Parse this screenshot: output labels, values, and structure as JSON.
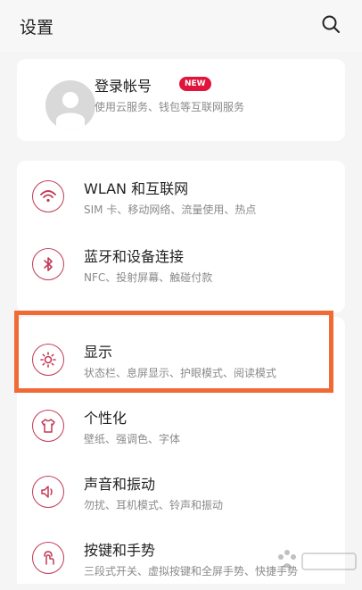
{
  "header": {
    "title": "设置",
    "search_icon": "search-icon"
  },
  "account": {
    "title": "登录帐号",
    "badge": "NEW",
    "subtitle": "使用云服务、钱包等互联网服务",
    "avatar_icon": "user-avatar-icon",
    "badge_color": "#e0143c"
  },
  "settings": {
    "items": [
      {
        "label": "WLAN 和互联网",
        "sub": "SIM 卡、移动网络、流量使用、热点",
        "icon": "wifi-icon"
      },
      {
        "label": "蓝牙和设备连接",
        "sub": "NFC、投射屏幕、触碰付款",
        "icon": "bluetooth-icon"
      },
      {
        "label": "显示",
        "sub": "状态栏、息屏显示、护眼模式、阅读模式",
        "icon": "brightness-icon"
      },
      {
        "label": "个性化",
        "sub": "壁纸、强调色、字体",
        "icon": "tshirt-icon"
      },
      {
        "label": "声音和振动",
        "sub": "勿扰、耳机模式、铃声和振动",
        "icon": "speaker-icon"
      },
      {
        "label": "按键和手势",
        "sub": "三段式开关、虚拟按键和全屏手势、快捷手势",
        "icon": "gesture-icon"
      }
    ]
  },
  "colors": {
    "accent": "#c23a57",
    "highlight": "#f06a36"
  }
}
